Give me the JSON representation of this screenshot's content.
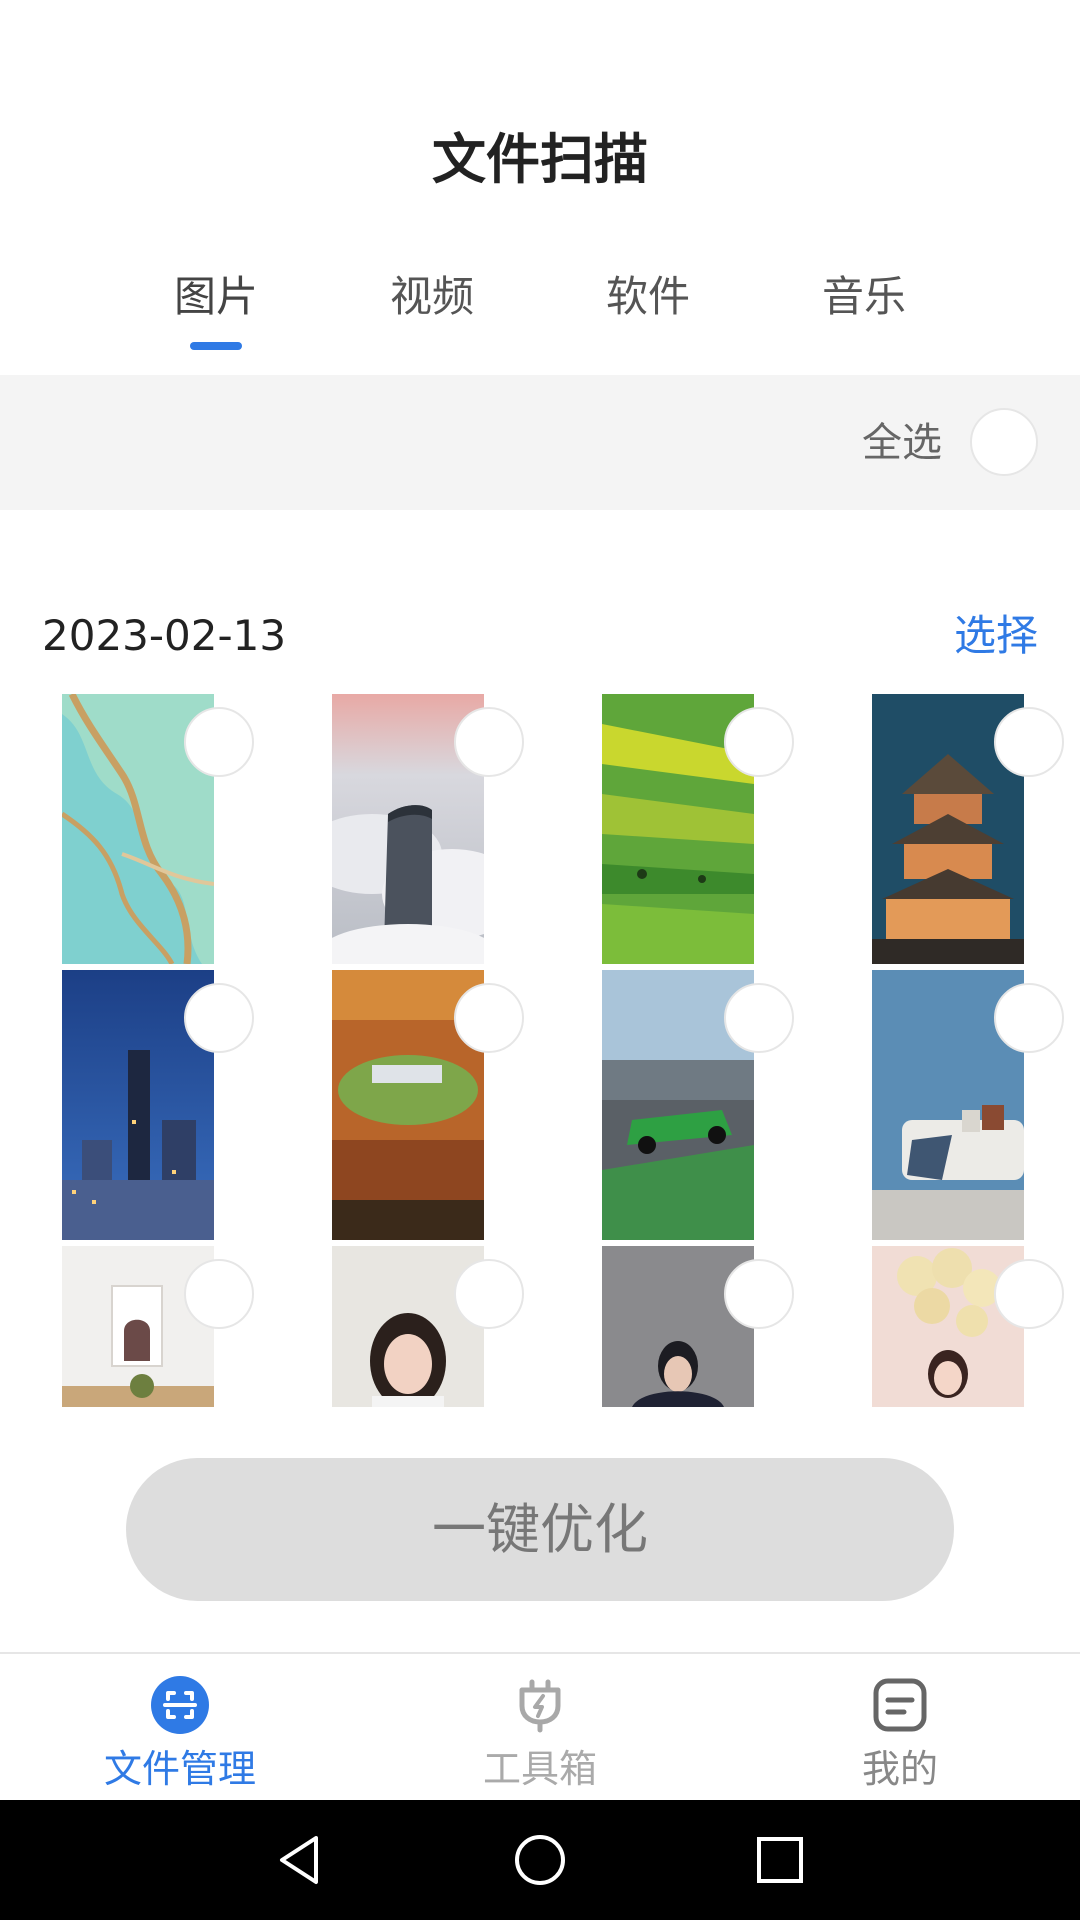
{
  "header": {
    "title": "文件扫描"
  },
  "tabs": [
    {
      "label": "图片",
      "active": true
    },
    {
      "label": "视频",
      "active": false
    },
    {
      "label": "软件",
      "active": false
    },
    {
      "label": "音乐",
      "active": false
    }
  ],
  "select_all": {
    "label": "全选",
    "checked": false
  },
  "section": {
    "date": "2023-02-13",
    "select_label": "选择"
  },
  "images": [
    {
      "subject": "marble texture",
      "selected": false
    },
    {
      "subject": "skyscraper above clouds",
      "selected": false
    },
    {
      "subject": "green terraced fields",
      "selected": false
    },
    {
      "subject": "pagoda at night",
      "selected": false
    },
    {
      "subject": "city night skyline",
      "selected": false
    },
    {
      "subject": "autumn forest campus",
      "selected": false
    },
    {
      "subject": "green race car",
      "selected": false
    },
    {
      "subject": "blue living room sofa",
      "selected": false
    },
    {
      "subject": "white room interior",
      "selected": false
    },
    {
      "subject": "portrait woman",
      "selected": false
    },
    {
      "subject": "portrait man",
      "selected": false
    },
    {
      "subject": "woman with balloons",
      "selected": false
    }
  ],
  "optimize_button": {
    "label": "一键优化",
    "enabled": false
  },
  "bottom_nav": [
    {
      "label": "文件管理",
      "icon": "scan-icon",
      "active": true
    },
    {
      "label": "工具箱",
      "icon": "plug-icon",
      "active": false
    },
    {
      "label": "我的",
      "icon": "profile-icon",
      "active": false
    }
  ],
  "system_nav": [
    "back-icon",
    "home-icon",
    "recents-icon"
  ],
  "colors": {
    "accent": "#2f7ae5",
    "inactive": "#aaaaaa",
    "bar_bg": "#f4f4f4"
  }
}
